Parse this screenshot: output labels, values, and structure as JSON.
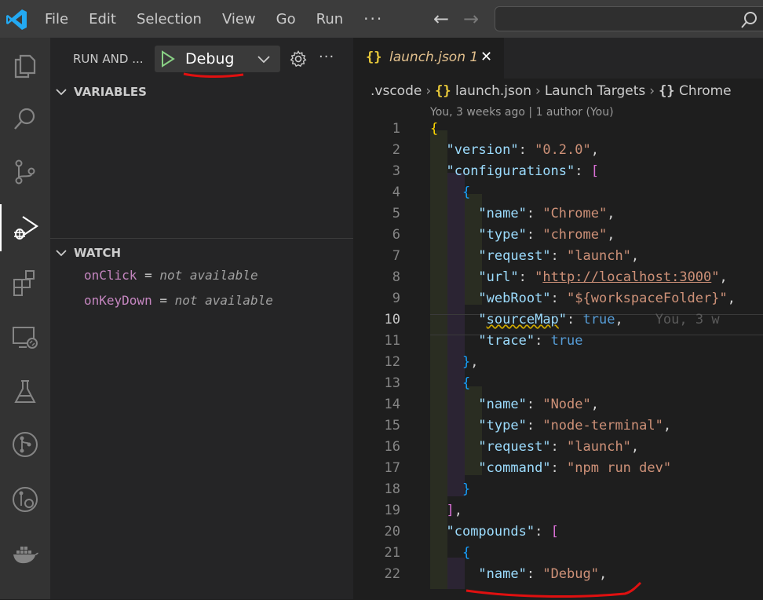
{
  "menu": [
    "File",
    "Edit",
    "Selection",
    "View",
    "Go",
    "Run",
    "···"
  ],
  "run_panel": {
    "title": "RUN AND ...",
    "config": "Debug",
    "more": "···",
    "variables_header": "VARIABLES",
    "watch_header": "WATCH",
    "watch": [
      {
        "name": "onClick",
        "eq": " = ",
        "value": "not available"
      },
      {
        "name": "onKeyDown",
        "eq": " = ",
        "value": "not available"
      }
    ]
  },
  "editor": {
    "tab": {
      "icon": "{}",
      "label": "launch.json 1",
      "close": "✕"
    },
    "breadcrumb": [
      ".vscode",
      "launch.json",
      "Launch Targets",
      "Chrome"
    ],
    "blame": "You, 3 weeks ago | 1 author (You)",
    "inline_blame": "You, 3 w",
    "active_line": 10,
    "lines": [
      {
        "n": "1"
      },
      {
        "n": "2"
      },
      {
        "n": "3"
      },
      {
        "n": "4"
      },
      {
        "n": "5"
      },
      {
        "n": "6"
      },
      {
        "n": "7"
      },
      {
        "n": "8"
      },
      {
        "n": "9"
      },
      {
        "n": "10"
      },
      {
        "n": "11"
      },
      {
        "n": "12"
      },
      {
        "n": "13"
      },
      {
        "n": "14"
      },
      {
        "n": "15"
      },
      {
        "n": "16"
      },
      {
        "n": "17"
      },
      {
        "n": "18"
      },
      {
        "n": "19"
      },
      {
        "n": "20"
      },
      {
        "n": "21"
      },
      {
        "n": "22"
      }
    ],
    "code": {
      "version_key": "\"version\"",
      "version_val": "\"0.2.0\"",
      "configurations_key": "\"configurations\"",
      "name_key": "\"name\"",
      "chrome_val": "\"Chrome\"",
      "type_key": "\"type\"",
      "chrome_type": "\"chrome\"",
      "request_key": "\"request\"",
      "launch_val": "\"launch\"",
      "url_key": "\"url\"",
      "url_q": "\"",
      "url_val": "http://localhost:3000",
      "webroot_key": "\"webRoot\"",
      "webroot_val": "\"${workspaceFolder}\"",
      "sourcemap_q": "\"",
      "sourcemap_key": "sourceMap",
      "true_val": "true",
      "trace_key": "\"trace\"",
      "node_val": "\"Node\"",
      "node_type": "\"node-terminal\"",
      "command_key": "\"command\"",
      "command_val": "\"npm run dev\"",
      "compounds_key": "\"compounds\"",
      "debug_val": "\"Debug\""
    }
  },
  "colors": {
    "accent": "#0078d4",
    "activity_bg": "#333333",
    "sidebar_bg": "#252526",
    "editor_bg": "#1e1e1e",
    "annotation": "#e01010"
  }
}
